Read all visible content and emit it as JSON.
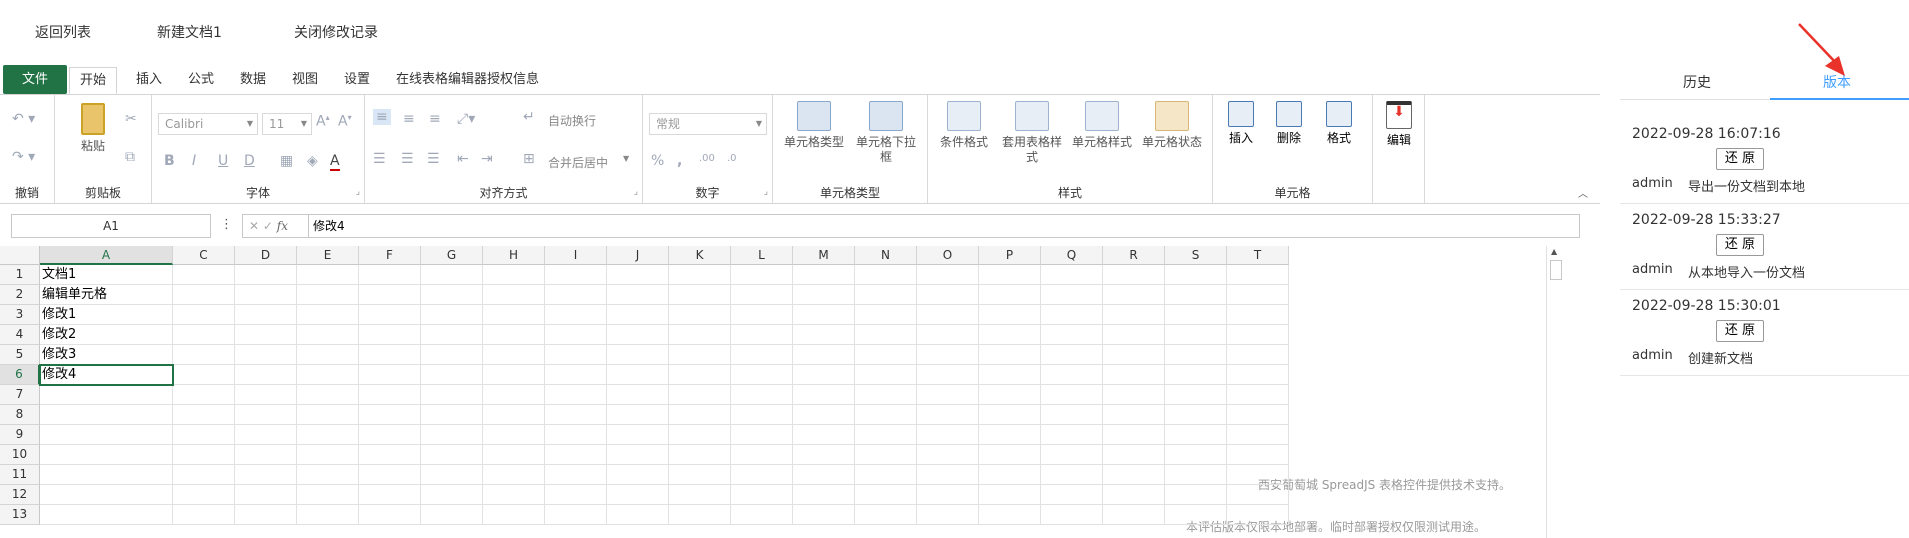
{
  "topbar": {
    "back": "返回列表",
    "doc_title": "新建文档1",
    "close_history": "关闭修改记录"
  },
  "ribbon_tabs": [
    "文件",
    "开始",
    "插入",
    "公式",
    "数据",
    "视图",
    "设置",
    "在线表格编辑器授权信息"
  ],
  "ribbon": {
    "undo_group": "撤销",
    "clipboard_group": "剪贴板",
    "paste": "粘贴",
    "font_group": "字体",
    "font_name": "Calibri",
    "font_size": "11",
    "align_group": "对齐方式",
    "wrap": "自动换行",
    "merge": "合并后居中",
    "number_group": "数字",
    "number_format": "常规",
    "celltype_group": "单元格类型",
    "celltype_btn1": "单元格类型",
    "celltype_btn2": "单元格下拉框",
    "style_group": "样式",
    "cond_format": "条件格式",
    "table_style": "套用表格样式",
    "cell_style": "单元格样式",
    "cell_state": "单元格状态",
    "cells_group": "单元格",
    "insert": "插入",
    "delete": "删除",
    "format": "格式",
    "edit": "编辑"
  },
  "formula_bar": {
    "name_box": "A1",
    "value": "修改4",
    "fx": "fx"
  },
  "grid": {
    "columns": [
      "A",
      "C",
      "D",
      "E",
      "F",
      "G",
      "H",
      "I",
      "J",
      "K",
      "L",
      "M",
      "N",
      "O",
      "P",
      "Q",
      "R",
      "S",
      "T"
    ],
    "rows": [
      "1",
      "2",
      "3",
      "4",
      "5",
      "6",
      "7",
      "8",
      "9",
      "10",
      "11",
      "12",
      "13"
    ],
    "colA": [
      "文档1",
      "编辑单元格",
      "修改1",
      "修改2",
      "修改3",
      "修改4"
    ],
    "watermark1": "西安葡萄城 SpreadJS 表格控件提供技术支持。",
    "watermark2": "本评估版本仅限本地部署。临时部署授权仅限测试用途。"
  },
  "panel": {
    "tab_history": "历史",
    "tab_version": "版本",
    "restore_label": "还 原",
    "versions": [
      {
        "time": "2022-09-28 16:07:16",
        "user": "admin",
        "desc": "导出一份文档到本地"
      },
      {
        "time": "2022-09-28 15:33:27",
        "user": "admin",
        "desc": "从本地导入一份文档"
      },
      {
        "time": "2022-09-28 15:30:01",
        "user": "admin",
        "desc": "创建新文档"
      }
    ]
  },
  "colors": {
    "excel_green": "#217346",
    "accent_blue": "#409eff",
    "arrow_red": "#e8322a"
  }
}
